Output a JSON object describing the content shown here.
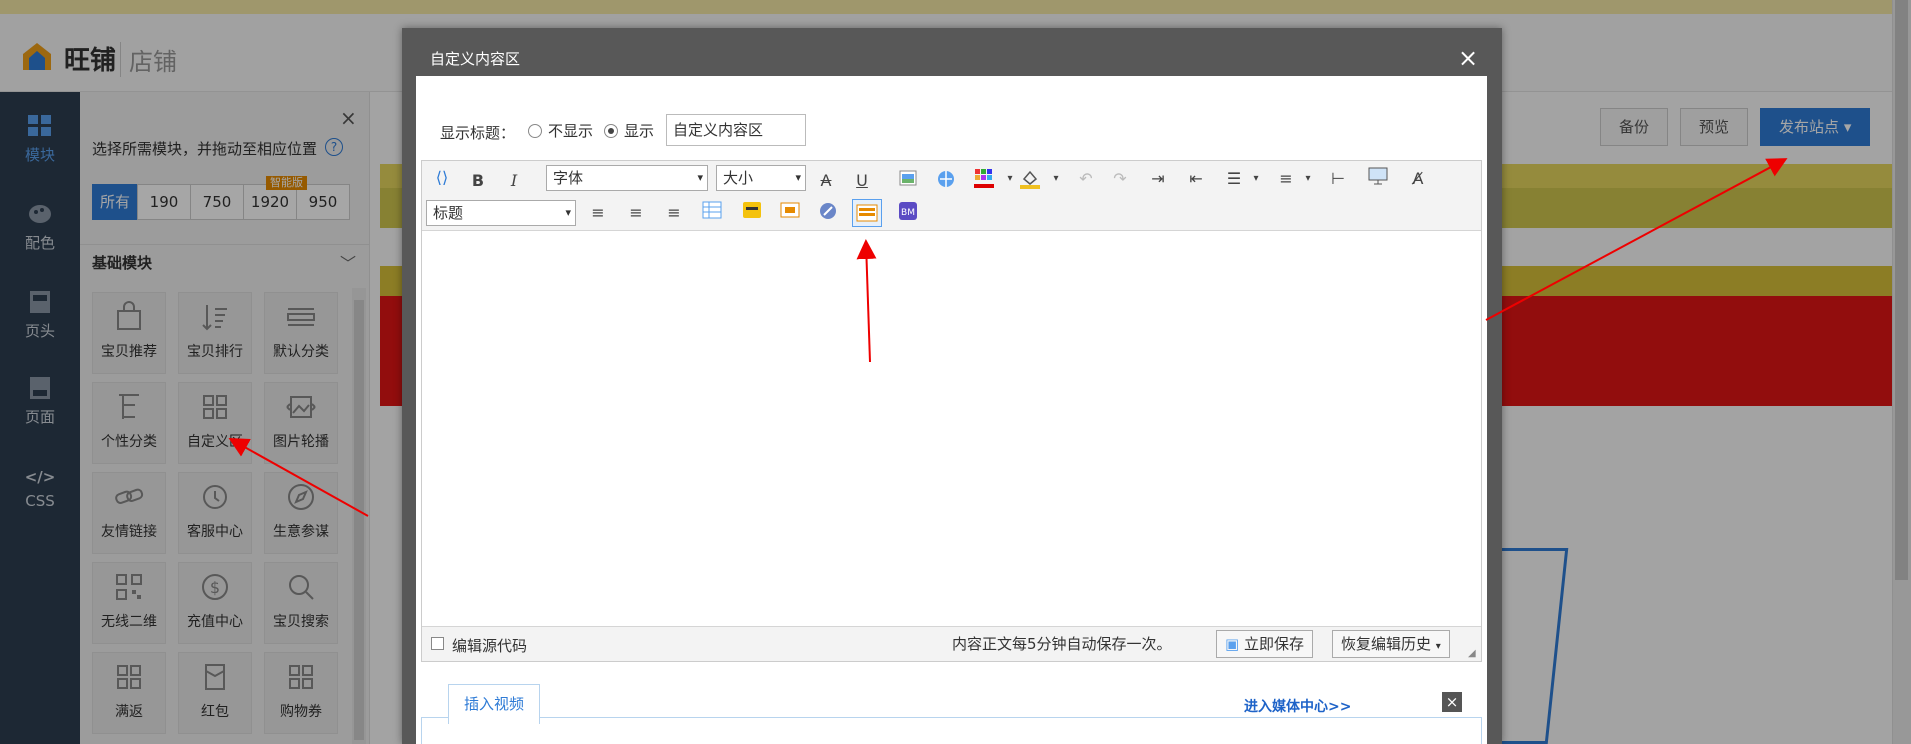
{
  "header": {
    "logo_text": "旺铺",
    "logo_sub": "店铺"
  },
  "left_nav": [
    {
      "label": "模块",
      "icon": "grid-icon",
      "active": true
    },
    {
      "label": "配色",
      "icon": "palette-icon"
    },
    {
      "label": "页头",
      "icon": "page-header-icon"
    },
    {
      "label": "页面",
      "icon": "page-icon"
    },
    {
      "label": "CSS",
      "icon": "code-icon",
      "code": "</>"
    }
  ],
  "module_panel": {
    "hint": "选择所需模块，并拖动至相应位置",
    "help": "?",
    "close": "×",
    "tabs": [
      "所有",
      "190",
      "750",
      "1920",
      "950"
    ],
    "smart_tag": "智能版",
    "section_title": "基础模块",
    "modules": [
      {
        "label": "宝贝推荐",
        "icon": "bag-icon"
      },
      {
        "label": "宝贝排行",
        "icon": "sort-icon"
      },
      {
        "label": "默认分类",
        "icon": "list-icon"
      },
      {
        "label": "个性分类",
        "icon": "tree-icon"
      },
      {
        "label": "自定义区",
        "icon": "grid-icon"
      },
      {
        "label": "图片轮播",
        "icon": "image-carousel-icon"
      },
      {
        "label": "友情链接",
        "icon": "link-icon"
      },
      {
        "label": "客服中心",
        "icon": "service-icon"
      },
      {
        "label": "生意参谋",
        "icon": "compass-icon"
      },
      {
        "label": "无线二维",
        "icon": "qrcode-icon"
      },
      {
        "label": "充值中心",
        "icon": "dollar-icon"
      },
      {
        "label": "宝贝搜索",
        "icon": "search-icon"
      },
      {
        "label": "满返",
        "icon": "grid-icon"
      },
      {
        "label": "红包",
        "icon": "redpacket-icon"
      },
      {
        "label": "购物券",
        "icon": "grid-icon"
      }
    ]
  },
  "toolbar": {
    "backup": "备份",
    "preview": "预览",
    "publish": "发布站点"
  },
  "dialog": {
    "title": "自定义内容区",
    "close": "×",
    "show_title_label": "显示标题：",
    "option_hide": "不显示",
    "option_show": "显示",
    "title_value": "自定义内容区",
    "font_select": "字体",
    "size_select": "大小",
    "heading_select": "标题",
    "bold": "B",
    "italic": "I",
    "underline": "U",
    "strike": "A",
    "source_code_label": "编辑源代码",
    "autosave_text": "内容正文每5分钟自动保存一次。",
    "save_now": "立即保存",
    "restore_history": "恢复编辑历史",
    "video_tab": "插入视频",
    "media_link": "进入媒体中心>>",
    "video_close": "×"
  }
}
